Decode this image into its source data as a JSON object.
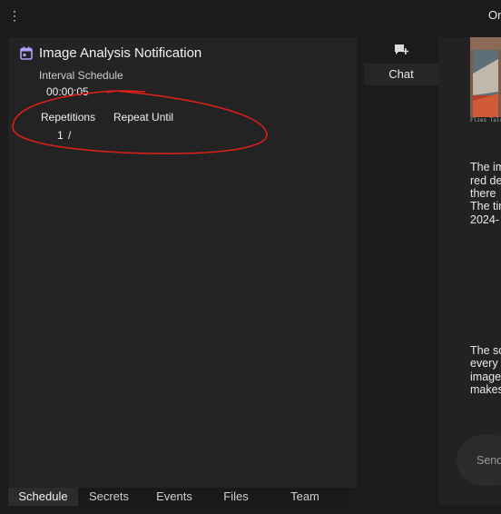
{
  "topbar": {
    "menu_icon": "kebab-vertical-icon",
    "right_text": "On"
  },
  "schedule": {
    "icon": "calendar-icon",
    "title": "Image Analysis Notification",
    "interval_label": "Interval Schedule",
    "interval_value": "00:00:05",
    "repetitions_label": "Repetitions",
    "repeat_until_label": "Repeat Until",
    "repetitions_value": "1",
    "separator": "/"
  },
  "tabs": [
    {
      "label": "Schedule",
      "active": true
    },
    {
      "label": "Secrets",
      "active": false
    },
    {
      "label": "Events",
      "active": false
    },
    {
      "label": "Files",
      "active": false
    },
    {
      "label": "Team",
      "active": false
    }
  ],
  "chat": {
    "new_chat_icon": "chat-plus-icon",
    "tab_label": "Chat",
    "image_caption": "Flies Tals",
    "message1": [
      "The im",
      "red de",
      "there",
      "The tin",
      "2024-"
    ],
    "message2": [
      "The sc",
      "every",
      "image",
      "makes"
    ],
    "send_placeholder": "Send"
  },
  "colors": {
    "annotation": "#e0201b",
    "panel": "#232323",
    "background": "#1b1b1b"
  }
}
